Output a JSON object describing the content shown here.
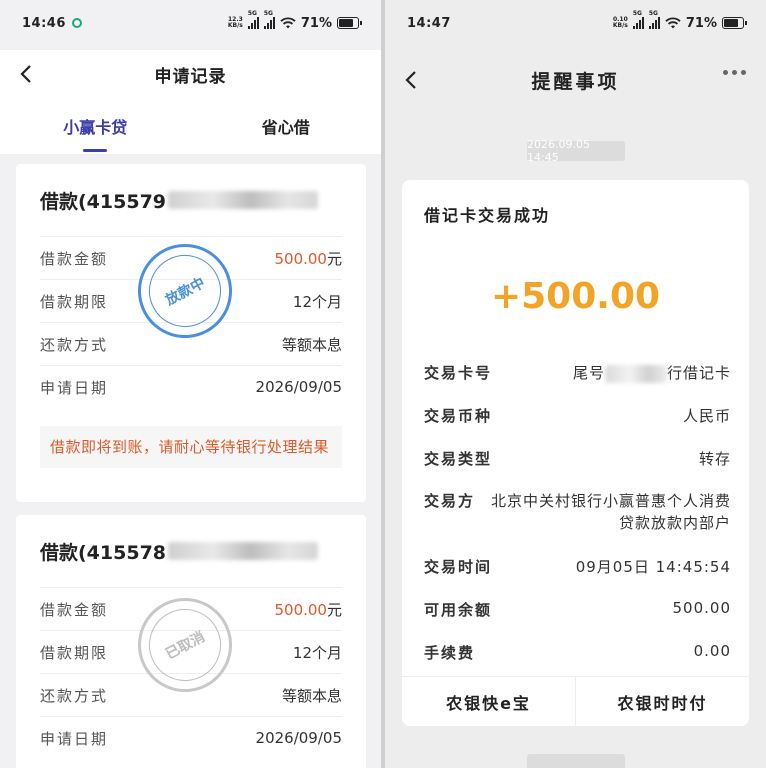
{
  "left": {
    "status": {
      "time": "14:46",
      "speed": "12.3",
      "speed_unit": "KB/s",
      "net1": "5G",
      "net2": "5G",
      "battery": "71%"
    },
    "title": "申请记录",
    "tabs": [
      {
        "label": "小赢卡贷"
      },
      {
        "label": "省心借"
      }
    ],
    "cards": [
      {
        "title": "借款(415579",
        "rows": [
          {
            "label": "借款金额",
            "value": "500.00",
            "unit": "元"
          },
          {
            "label": "借款期限",
            "value": "12个月"
          },
          {
            "label": "还款方式",
            "value": "等额本息"
          },
          {
            "label": "申请日期",
            "value": "2026/09/05"
          }
        ],
        "stamp": "放款中",
        "notice": "借款即将到账，请耐心等待银行处理结果"
      },
      {
        "title": "借款(415578",
        "rows": [
          {
            "label": "借款金额",
            "value": "500.00",
            "unit": "元"
          },
          {
            "label": "借款期限",
            "value": "12个月"
          },
          {
            "label": "还款方式",
            "value": "等额本息"
          },
          {
            "label": "申请日期",
            "value": "2026/09/05"
          }
        ],
        "stamp": "已取消"
      }
    ]
  },
  "right": {
    "status": {
      "time": "14:47",
      "speed": "0.10",
      "speed_unit": "KB/s",
      "net1": "5G",
      "net2": "5G",
      "battery": "71%"
    },
    "title": "提醒事项",
    "time_chip": "2026.09.05 14:45",
    "message": {
      "title": "借记卡交易成功",
      "amount": "+500.00",
      "details": [
        {
          "label": "交易卡号",
          "value_prefix": "尾号",
          "value_suffix": "行借记卡"
        },
        {
          "label": "交易币种",
          "value": "人民币"
        },
        {
          "label": "交易类型",
          "value": "转存"
        },
        {
          "label": "交易方",
          "value": "北京中关村银行小赢普惠个人消费贷款放款内部户"
        },
        {
          "label": "交易时间",
          "value": "09月05日 14:45:54"
        },
        {
          "label": "可用余额",
          "value": "500.00"
        },
        {
          "label": "手续费",
          "value": "0.00"
        }
      ],
      "actions": [
        {
          "label": "农银快e宝"
        },
        {
          "label": "农银时时付"
        }
      ]
    }
  },
  "colors": {
    "accent": "#3b3ea8",
    "amount_orange": "#e0592a",
    "gold": "#f2a428",
    "stamp_blue": "#4a8fe0"
  }
}
